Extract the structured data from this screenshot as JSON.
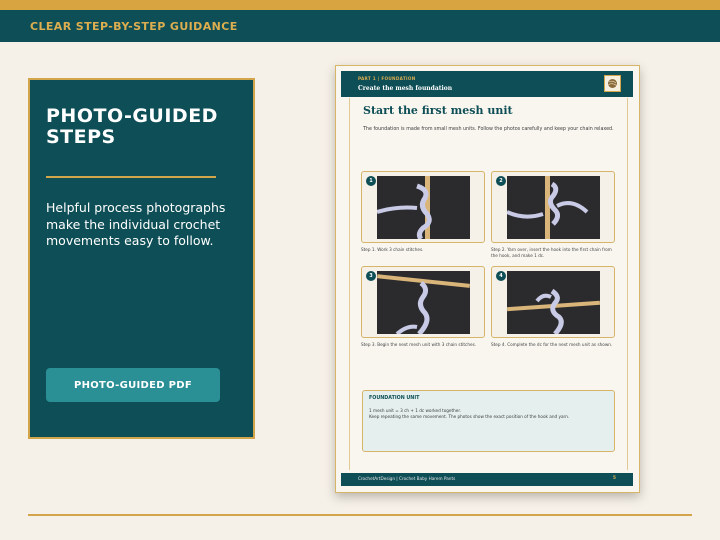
{
  "banner": {
    "label": "CLEAR STEP-BY-STEP GUIDANCE"
  },
  "left_panel": {
    "title": "PHOTO-GUIDED STEPS",
    "description": "Helpful process photographs make the individual crochet movements easy to follow.",
    "button_label": "PHOTO-GUIDED PDF"
  },
  "document": {
    "part_label": "PART 1 | FOUNDATION",
    "section_title": "Create the mesh foundation",
    "heading": "Start the first mesh unit",
    "intro": "The foundation is made from small mesh units. Follow the photos carefully and keep your chain relaxed.",
    "steps": [
      {
        "number": "1",
        "caption": "Step 1. Work 3 chain stitches."
      },
      {
        "number": "2",
        "caption": "Step 2. Yarn over, insert the hook into the first chain from the hook, and make 1 dc."
      },
      {
        "number": "3",
        "caption": "Step 3. Begin the next mesh unit with 3 chain stitches."
      },
      {
        "number": "4",
        "caption": "Step 4. Complete the dc for the next mesh unit as shown."
      }
    ],
    "info_box": {
      "title": "FOUNDATION UNIT",
      "line1": "1 mesh unit = 3 ch + 1 dc worked together.",
      "line2": "Keep repeating the same movement. The photos show the exact position of the hook and yarn."
    },
    "footer_text": "CrochetArtDesign  |  Crochet Baby Harem Pants",
    "page_number": "5"
  },
  "colors": {
    "primary": "#0e4e56",
    "accent": "#d7a441",
    "button": "#2a9096",
    "background": "#f6f1e8"
  }
}
